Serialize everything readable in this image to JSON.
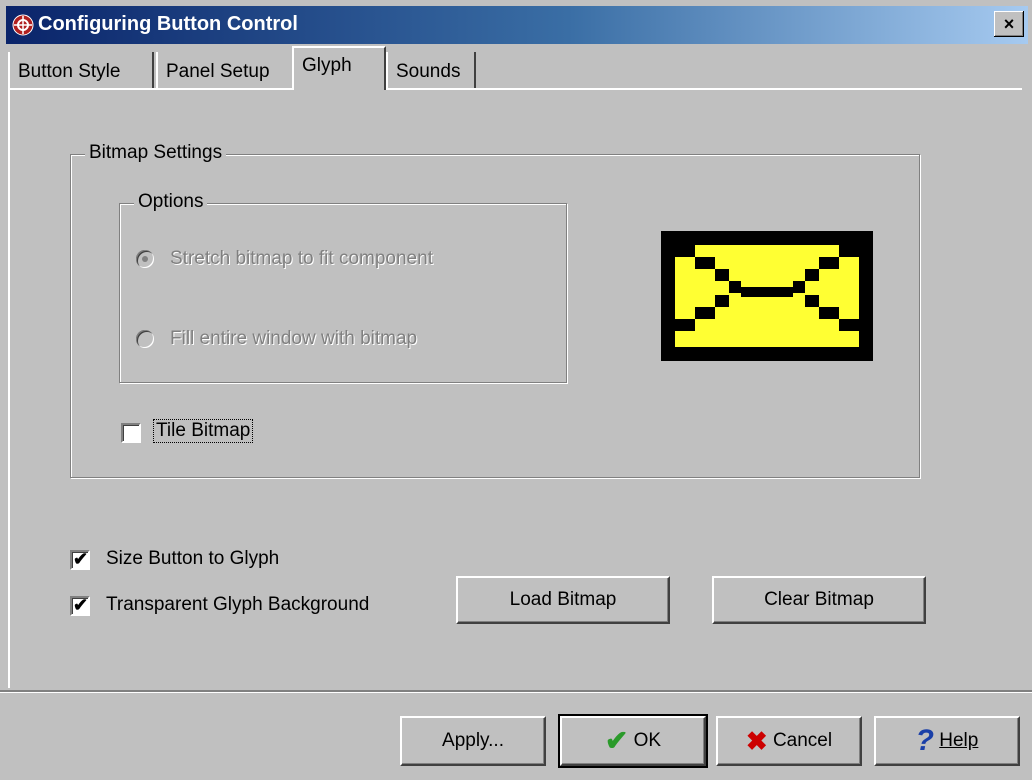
{
  "window": {
    "title": "Configuring Button Control",
    "close_glyph": "×"
  },
  "tabs": [
    {
      "label": "Button Style"
    },
    {
      "label": "Panel Setup"
    },
    {
      "label": "Glyph"
    },
    {
      "label": "Sounds"
    }
  ],
  "bitmap_settings": {
    "label": "Bitmap Settings",
    "options_label": "Options",
    "radio_stretch": "Stretch bitmap to fit component",
    "radio_fill": "Fill entire window with bitmap",
    "tile_label": "Tile Bitmap"
  },
  "checks": {
    "size_button": "Size Button to Glyph",
    "transparent_bg": "Transparent Glyph Background"
  },
  "buttons": {
    "load": "Load Bitmap",
    "clear": "Clear Bitmap",
    "apply": "Apply...",
    "ok": "OK",
    "cancel": "Cancel",
    "help": "Help"
  },
  "colors": {
    "face": "#c0c0c0",
    "title_start": "#0a246a",
    "envelope_fill": "#ffff33",
    "envelope_border": "#000000",
    "ok_check": "#2a9a2a",
    "cancel_x": "#cc0000",
    "help_q": "#1a3fa8"
  },
  "icons": [
    "app-icon",
    "envelope-glyph-preview",
    "ok-check-icon",
    "cancel-x-icon",
    "help-question-icon"
  ]
}
